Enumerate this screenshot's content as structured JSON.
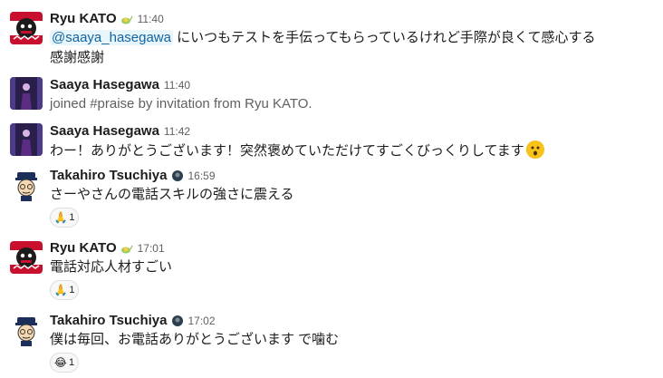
{
  "messages": [
    {
      "name": "Ryu KATO",
      "status_icon": "snail-icon",
      "time": "11:40",
      "mention": "@saaya_hasegawa",
      "text_after_mention": " にいつもテストを手伝ってもらっているけれど手際が良くて感心する",
      "text_line2": "感謝感謝"
    },
    {
      "name": "Saaya Hasegawa",
      "time": "11:40",
      "text": "joined #praise by invitation from Ryu KATO."
    },
    {
      "name": "Saaya Hasegawa",
      "time": "11:42",
      "text": "わー！ありがとうございます！突然褒めていただけてすごくびっくりしてます",
      "emoji": "astonished-face-emoji"
    },
    {
      "name": "Takahiro Tsuchiya",
      "status_icon": "dark-circle-icon",
      "time": "16:59",
      "text": "さーやさんの電話スキルの強さに震える",
      "reaction": {
        "emoji": "pray-emoji",
        "glyph": "🙏",
        "count": "1"
      }
    },
    {
      "name": "Ryu KATO",
      "status_icon": "snail-icon",
      "time": "17:01",
      "text": "電話対応人材すごい",
      "reaction": {
        "emoji": "pray-emoji",
        "glyph": "🙏",
        "count": "1"
      }
    },
    {
      "name": "Takahiro Tsuchiya",
      "status_icon": "dark-circle-icon",
      "time": "17:02",
      "text": "僕は毎回、お電話ありがとうございます で噛む",
      "reaction": {
        "emoji": "joy-emoji",
        "glyph": "😂",
        "count": "1"
      }
    }
  ]
}
